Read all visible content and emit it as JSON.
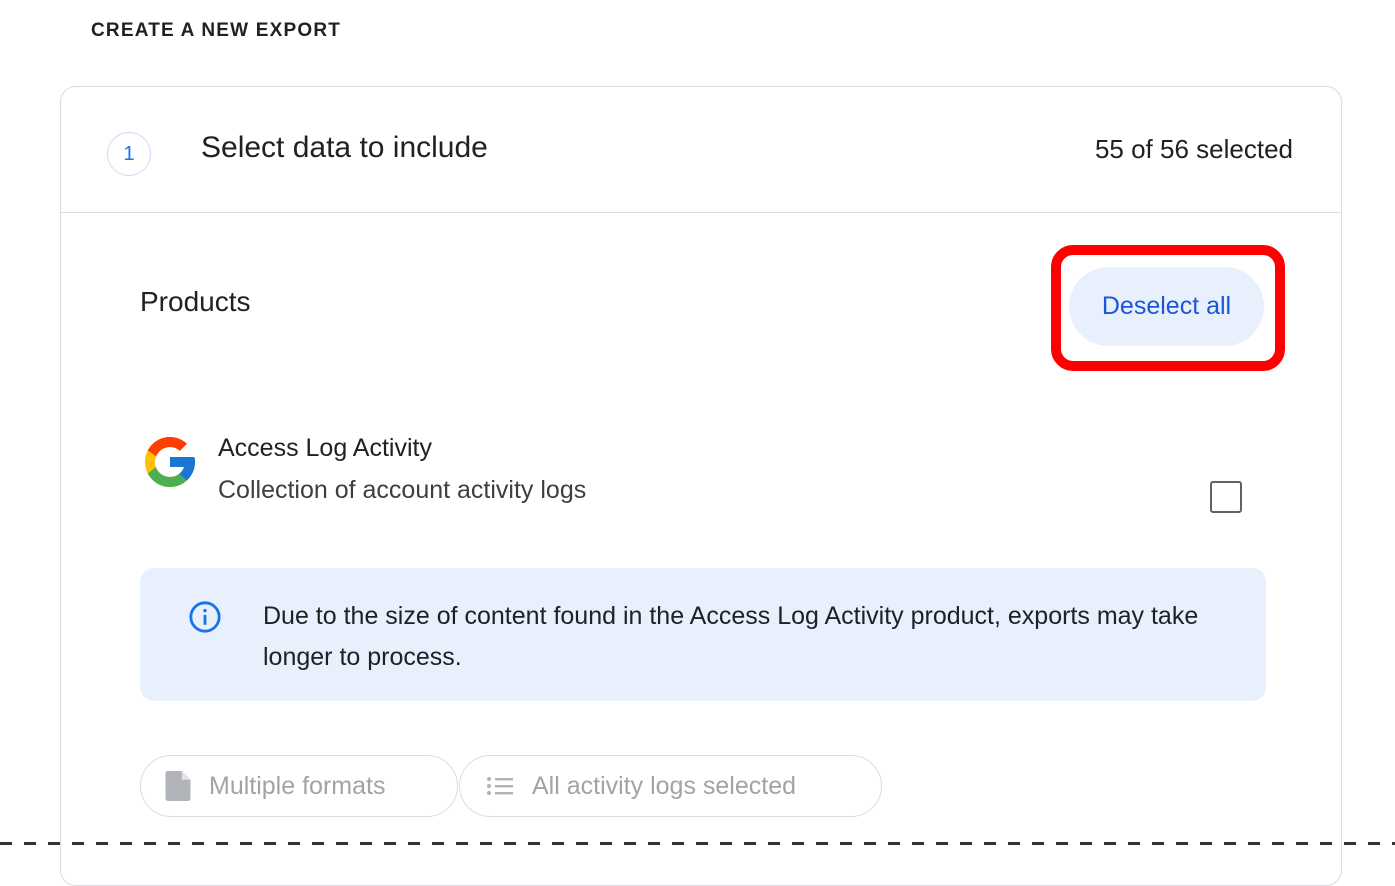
{
  "section": {
    "heading": "CREATE A NEW EXPORT"
  },
  "step": {
    "number": "1",
    "title": "Select data to include",
    "selected_count": "55 of 56 selected"
  },
  "products": {
    "label": "Products",
    "deselect_label": "Deselect all",
    "items": [
      {
        "name": "Access Log Activity",
        "description": "Collection of account activity logs",
        "logo": "google-g-icon",
        "checked": false,
        "info": "Due to the size of content found in the Access Log Activity product, exports may take longer to process.",
        "chips": [
          {
            "label": "Multiple formats",
            "icon": "file-icon"
          },
          {
            "label": "All activity logs selected",
            "icon": "list-icon"
          }
        ]
      }
    ]
  },
  "colors": {
    "accent": "#1a73e8",
    "button_bg": "#e8f0fe",
    "highlight": "#ff0000",
    "info_bg": "#e8f0fe"
  }
}
